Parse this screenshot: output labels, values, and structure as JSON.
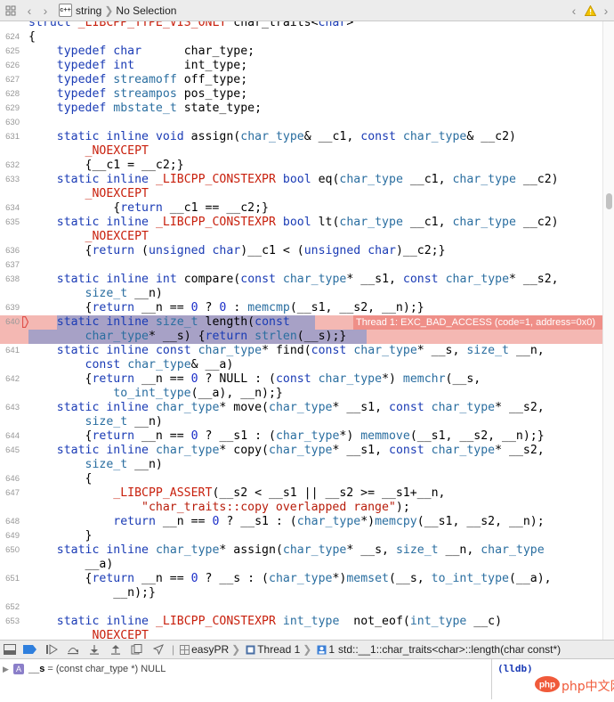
{
  "toolbar": {
    "file_label": "string",
    "selection_label": "No Selection",
    "file_badge": "c++"
  },
  "code_lines": [
    {
      "no": "",
      "html": "<span class=\"k\">struct</span> <span class=\"m\">_LIBCPP_TYPE_VIS_ONLY</span> char_traits&lt;<span class=\"k\">char</span>&gt;"
    },
    {
      "no": "624",
      "html": "{"
    },
    {
      "no": "625",
      "html": "    <span class=\"k\">typedef</span> <span class=\"k\">char</span>      char_type;"
    },
    {
      "no": "626",
      "html": "    <span class=\"k\">typedef</span> <span class=\"k\">int</span>       int_type;"
    },
    {
      "no": "627",
      "html": "    <span class=\"k\">typedef</span> <span class=\"t\">streamoff</span> off_type;"
    },
    {
      "no": "628",
      "html": "    <span class=\"k\">typedef</span> <span class=\"t\">streampos</span> pos_type;"
    },
    {
      "no": "629",
      "html": "    <span class=\"k\">typedef</span> <span class=\"t\">mbstate_t</span> state_type;"
    },
    {
      "no": "630",
      "html": ""
    },
    {
      "no": "631",
      "html": "    <span class=\"k\">static</span> <span class=\"k\">inline</span> <span class=\"k\">void</span> assign(<span class=\"t\">char_type</span>&amp; __c1, <span class=\"k\">const</span> <span class=\"t\">char_type</span>&amp; __c2)"
    },
    {
      "no": "",
      "html": "        <span class=\"m\">_NOEXCEPT</span>"
    },
    {
      "no": "632",
      "html": "        {__c1 = __c2;}"
    },
    {
      "no": "633",
      "html": "    <span class=\"k\">static</span> <span class=\"k\">inline</span> <span class=\"m\">_LIBCPP_CONSTEXPR</span> <span class=\"k\">bool</span> eq(<span class=\"t\">char_type</span> __c1, <span class=\"t\">char_type</span> __c2)"
    },
    {
      "no": "",
      "html": "        <span class=\"m\">_NOEXCEPT</span>"
    },
    {
      "no": "634",
      "html": "            {<span class=\"k\">return</span> __c1 == __c2;}"
    },
    {
      "no": "635",
      "html": "    <span class=\"k\">static</span> <span class=\"k\">inline</span> <span class=\"m\">_LIBCPP_CONSTEXPR</span> <span class=\"k\">bool</span> lt(<span class=\"t\">char_type</span> __c1, <span class=\"t\">char_type</span> __c2)"
    },
    {
      "no": "",
      "html": "        <span class=\"m\">_NOEXCEPT</span>"
    },
    {
      "no": "636",
      "html": "        {<span class=\"k\">return</span> (<span class=\"k\">unsigned</span> <span class=\"k\">char</span>)__c1 &lt; (<span class=\"k\">unsigned</span> <span class=\"k\">char</span>)__c2;}"
    },
    {
      "no": "637",
      "html": ""
    },
    {
      "no": "638",
      "html": "    <span class=\"k\">static</span> <span class=\"k\">inline</span> <span class=\"k\">int</span> compare(<span class=\"k\">const</span> <span class=\"t\">char_type</span>* __s1, <span class=\"k\">const</span> <span class=\"t\">char_type</span>* __s2,"
    },
    {
      "no": "",
      "html": "        <span class=\"t\">size_t</span> __n)"
    },
    {
      "no": "639",
      "html": "        {<span class=\"k\">return</span> __n == <span class=\"n\">0</span> ? <span class=\"n\">0</span> : <span class=\"t\">memcmp</span>(__s1, __s2, __n);}"
    },
    {
      "no": "640",
      "html": "    <span class=\"k\">static</span> <span class=\"k\">inline</span> <span class=\"t\">size_t</span> length(<span class=\"k\">const</span>"
    },
    {
      "no": "",
      "html": "        <span class=\"t\">char_type</span>* __s) {<span class=\"k\">return</span> <span class=\"t\">strlen</span>(__s);}"
    },
    {
      "no": "641",
      "html": "    <span class=\"k\">static</span> <span class=\"k\">inline</span> <span class=\"k\">const</span> <span class=\"t\">char_type</span>* find(<span class=\"k\">const</span> <span class=\"t\">char_type</span>* __s, <span class=\"t\">size_t</span> __n,"
    },
    {
      "no": "",
      "html": "        <span class=\"k\">const</span> <span class=\"t\">char_type</span>&amp; __a)"
    },
    {
      "no": "642",
      "html": "        {<span class=\"k\">return</span> __n == <span class=\"n\">0</span> ? NULL : (<span class=\"k\">const</span> <span class=\"t\">char_type</span>*) <span class=\"t\">memchr</span>(__s,"
    },
    {
      "no": "",
      "html": "            <span class=\"t\">to_int_type</span>(__a), __n);}"
    },
    {
      "no": "643",
      "html": "    <span class=\"k\">static</span> <span class=\"k\">inline</span> <span class=\"t\">char_type</span>* move(<span class=\"t\">char_type</span>* __s1, <span class=\"k\">const</span> <span class=\"t\">char_type</span>* __s2,"
    },
    {
      "no": "",
      "html": "        <span class=\"t\">size_t</span> __n)"
    },
    {
      "no": "644",
      "html": "        {<span class=\"k\">return</span> __n == <span class=\"n\">0</span> ? __s1 : (<span class=\"t\">char_type</span>*) <span class=\"t\">memmove</span>(__s1, __s2, __n);}"
    },
    {
      "no": "645",
      "html": "    <span class=\"k\">static</span> <span class=\"k\">inline</span> <span class=\"t\">char_type</span>* copy(<span class=\"t\">char_type</span>* __s1, <span class=\"k\">const</span> <span class=\"t\">char_type</span>* __s2,"
    },
    {
      "no": "",
      "html": "        <span class=\"t\">size_t</span> __n)"
    },
    {
      "no": "646",
      "html": "        {"
    },
    {
      "no": "647",
      "html": "            <span class=\"m\">_LIBCPP_ASSERT</span>(__s2 &lt; __s1 || __s2 &gt;= __s1+__n,"
    },
    {
      "no": "",
      "html": "                <span class=\"s\">\"char_traits::copy overlapped range\"</span>);"
    },
    {
      "no": "648",
      "html": "            <span class=\"k\">return</span> __n == <span class=\"n\">0</span> ? __s1 : (<span class=\"t\">char_type</span>*)<span class=\"t\">memcpy</span>(__s1, __s2, __n);"
    },
    {
      "no": "649",
      "html": "        }"
    },
    {
      "no": "650",
      "html": "    <span class=\"k\">static</span> <span class=\"k\">inline</span> <span class=\"t\">char_type</span>* assign(<span class=\"t\">char_type</span>* __s, <span class=\"t\">size_t</span> __n, <span class=\"t\">char_type</span>"
    },
    {
      "no": "",
      "html": "        __a)"
    },
    {
      "no": "651",
      "html": "        {<span class=\"k\">return</span> __n == <span class=\"n\">0</span> ? __s : (<span class=\"t\">char_type</span>*)<span class=\"t\">memset</span>(__s, <span class=\"t\">to_int_type</span>(__a),"
    },
    {
      "no": "",
      "html": "            __n);}"
    },
    {
      "no": "652",
      "html": ""
    },
    {
      "no": "653",
      "html": "    <span class=\"k\">static</span> <span class=\"k\">inline</span> <span class=\"m\">_LIBCPP_CONSTEXPR</span> <span class=\"t\">int_type</span>  not_eof(<span class=\"t\">int_type</span> __c)"
    },
    {
      "no": "",
      "html": "        <span class=\"m\">_NOEXCEPT</span>"
    }
  ],
  "error": {
    "message": "Thread 1: EXC_BAD_ACCESS (code=1, address=0x0)",
    "color": "#f4b8b3"
  },
  "debug_bar": {
    "target": "easyPR",
    "thread": "Thread 1",
    "frame_no": "1",
    "frame": "std::__1::char_traits<char>::length(char const*)"
  },
  "variables": {
    "badge": "A",
    "name": "__s",
    "value": "= (const char_type *) NULL"
  },
  "console": {
    "prompt": "(lldb)"
  },
  "watermark": {
    "label": "php中文网"
  }
}
